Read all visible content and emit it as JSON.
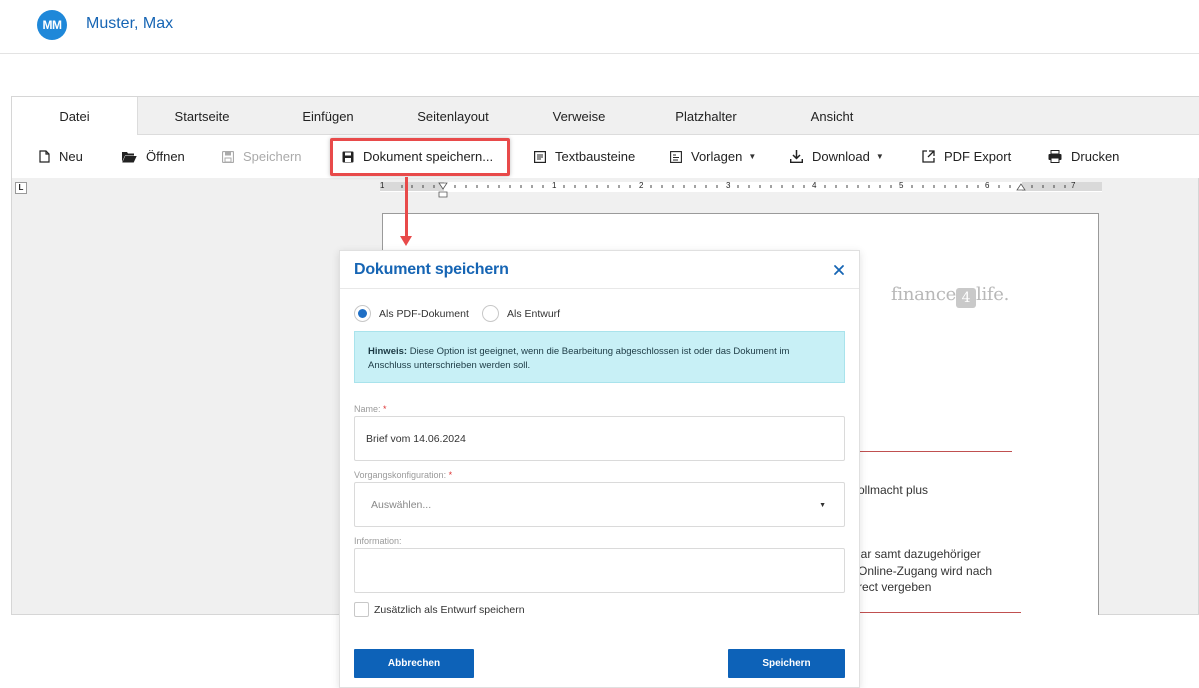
{
  "user": {
    "initials": "MM",
    "name": "Muster, Max"
  },
  "tabs": [
    {
      "label": "Datei",
      "active": true
    },
    {
      "label": "Startseite"
    },
    {
      "label": "Einfügen"
    },
    {
      "label": "Seitenlayout"
    },
    {
      "label": "Verweise"
    },
    {
      "label": "Platzhalter"
    },
    {
      "label": "Ansicht"
    }
  ],
  "toolbar": {
    "new": "Neu",
    "open": "Öffnen",
    "save": "Speichern",
    "save_document": "Dokument speichern...",
    "text_blocks": "Textbausteine",
    "templates": "Vorlagen",
    "download": "Download",
    "pdf_export": "PDF Export",
    "print": "Drucken"
  },
  "ruler": {
    "numbers": [
      "1",
      "1",
      "2",
      "3",
      "4",
      "5",
      "6",
      "7"
    ],
    "corner": "L"
  },
  "document": {
    "logo_left": "finance",
    "logo_mark": "4",
    "logo_right": "life.",
    "text_1": "ollmacht plus",
    "text_2": "lar samt dazugehöriger",
    "text_3": "Online-Zugang wird nach",
    "text_4": "rect vergeben"
  },
  "dialog": {
    "title": "Dokument speichern",
    "option_pdf": "Als PDF-Dokument",
    "option_draft": "Als Entwurf",
    "selected_option": "pdf",
    "hint_label": "Hinweis:",
    "hint_text": " Diese Option ist geeignet, wenn die Bearbeitung abgeschlossen ist oder das Dokument im Anschluss unterschrieben werden soll.",
    "name_label": "Name:",
    "name_value": "Brief vom 14.06.2024",
    "config_label": "Vorgangskonfiguration:",
    "config_placeholder": "Auswählen...",
    "info_label": "Information:",
    "info_value": "",
    "required_mark": "*",
    "also_draft_label": "Zusätzlich als Entwurf speichern",
    "also_draft_checked": false,
    "cancel": "Abbrechen",
    "save": "Speichern"
  },
  "colors": {
    "accent": "#1665b4",
    "button": "#0d62b8",
    "highlight": "#e84a4a",
    "hint_bg": "#c8f0f6"
  }
}
